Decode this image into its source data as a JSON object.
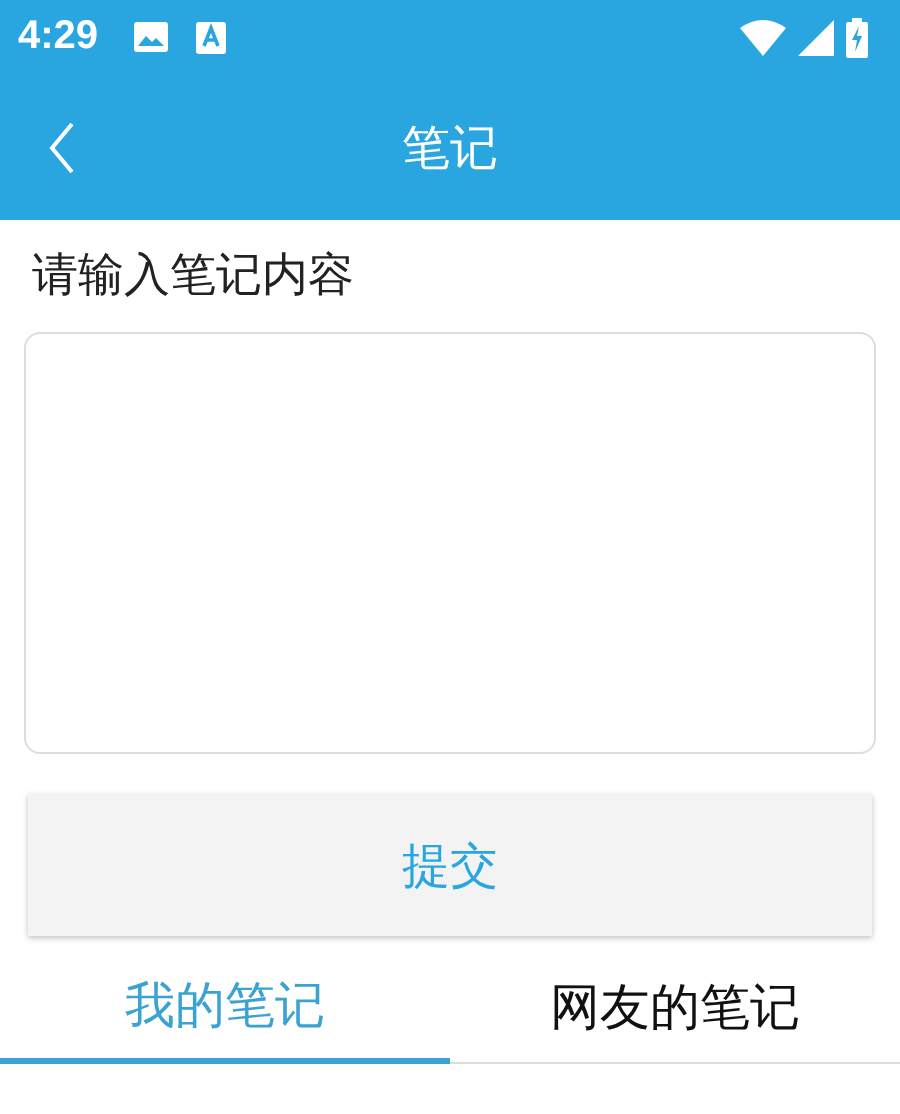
{
  "status_bar": {
    "time": "4:29"
  },
  "header": {
    "title": "笔记"
  },
  "note": {
    "label": "请输入笔记内容"
  },
  "submit_button": "提交",
  "tabs": [
    {
      "label": "我的笔记",
      "selected": true
    },
    {
      "label": "网友的笔记",
      "selected": false
    }
  ]
}
